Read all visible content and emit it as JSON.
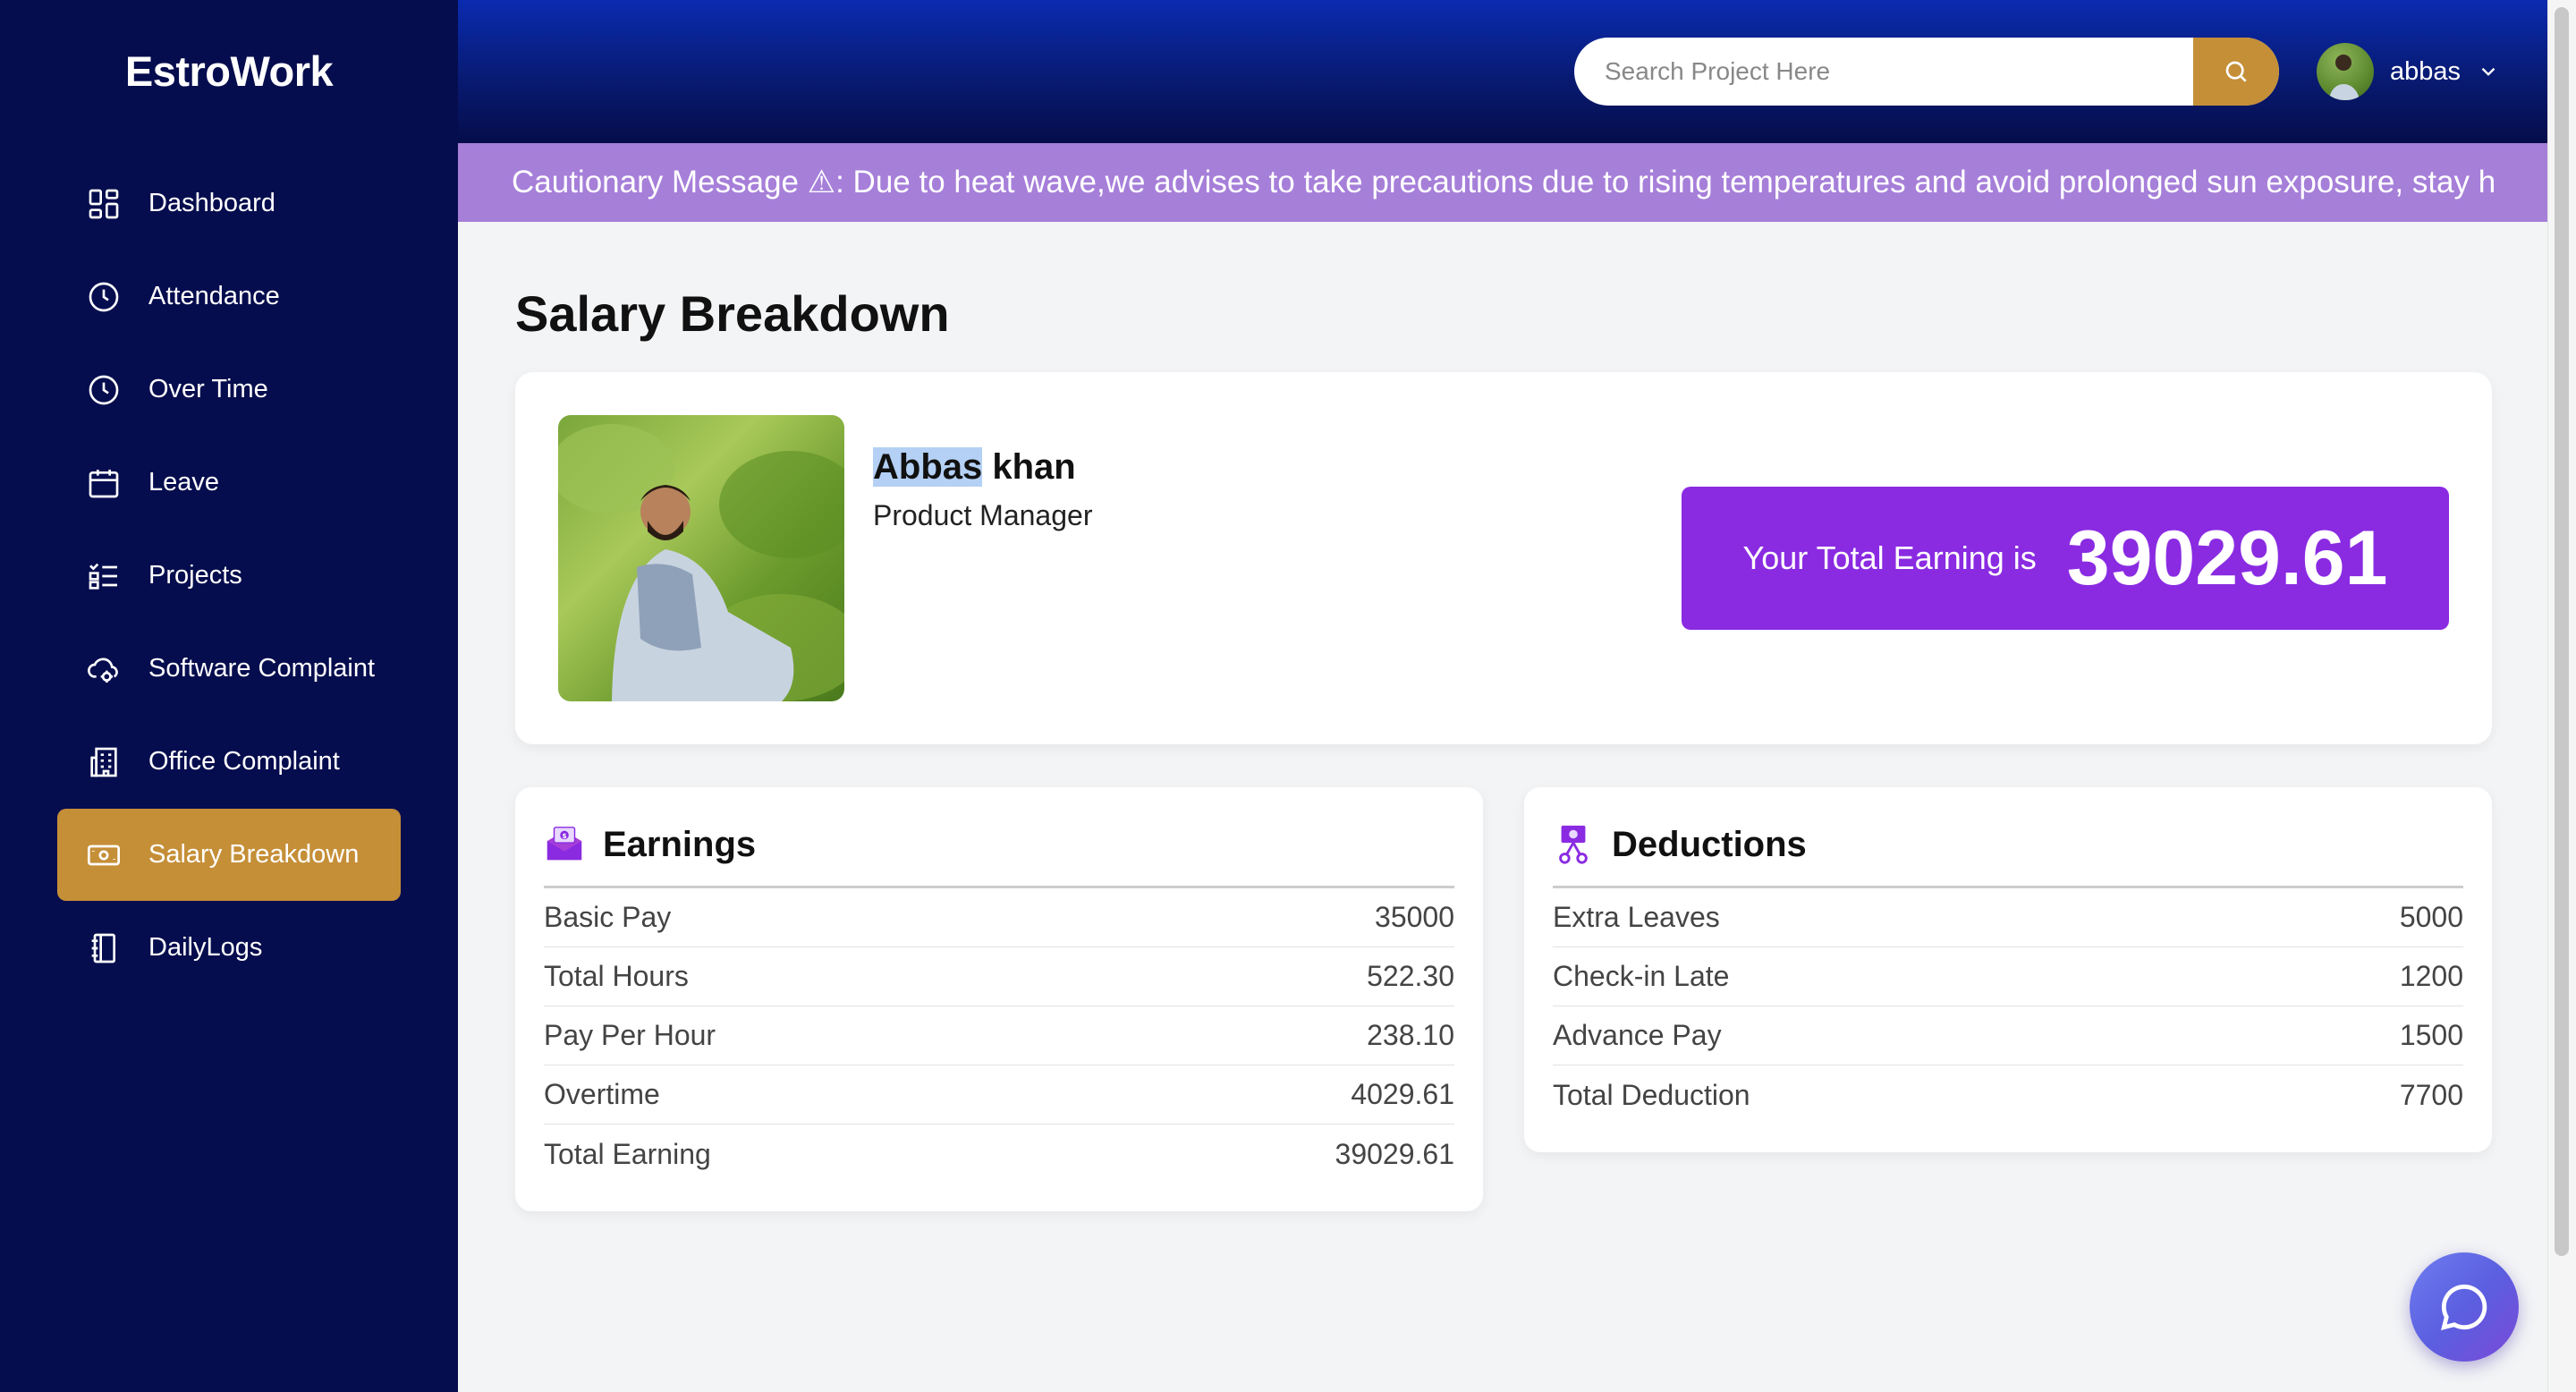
{
  "app": {
    "brand": "EstroWork"
  },
  "sidebar": {
    "items": [
      {
        "label": "Dashboard",
        "icon": "dashboard-grid-icon"
      },
      {
        "label": "Attendance",
        "icon": "clock-icon"
      },
      {
        "label": "Over Time",
        "icon": "clock-icon"
      },
      {
        "label": "Leave",
        "icon": "calendar-icon"
      },
      {
        "label": "Projects",
        "icon": "checklist-icon"
      },
      {
        "label": "Software Complaint",
        "icon": "cloud-gear-icon"
      },
      {
        "label": "Office Complaint",
        "icon": "building-icon"
      },
      {
        "label": "Salary Breakdown",
        "icon": "cash-icon",
        "active": true
      },
      {
        "label": "DailyLogs",
        "icon": "notebook-icon"
      }
    ],
    "active_color": "#c58f38",
    "background": "#060d4e"
  },
  "header": {
    "search": {
      "placeholder": "Search Project Here",
      "value": ""
    },
    "user": {
      "name": "abbas"
    }
  },
  "banner": {
    "text": "Cautionary Message ⚠: Due to heat wave,we advises to take precautions due to rising temperatures and avoid prolonged sun exposure, stay h"
  },
  "page": {
    "title": "Salary Breakdown"
  },
  "profile": {
    "first_name": "Abbas",
    "last_name": " khan",
    "role": "Product Manager",
    "total_label": "Your Total Earning is",
    "total_value": "39029.61",
    "accent_color": "#8a2be2"
  },
  "earnings": {
    "title": "Earnings",
    "icon": "money-envelope-icon",
    "rows": [
      {
        "label": "Basic Pay",
        "value": "35000"
      },
      {
        "label": "Total Hours",
        "value": "522.30"
      },
      {
        "label": "Pay Per Hour",
        "value": "238.10"
      },
      {
        "label": "Overtime",
        "value": "4029.61"
      },
      {
        "label": "Total Earning",
        "value": "39029.61"
      }
    ]
  },
  "deductions": {
    "title": "Deductions",
    "icon": "scissors-coin-icon",
    "rows": [
      {
        "label": "Extra Leaves",
        "value": "5000"
      },
      {
        "label": "Check-in Late",
        "value": "1200"
      },
      {
        "label": "Advance Pay",
        "value": "1500"
      },
      {
        "label": "Total Deduction",
        "value": "7700"
      }
    ]
  },
  "chat": {
    "icon": "chat-bubble-icon"
  }
}
